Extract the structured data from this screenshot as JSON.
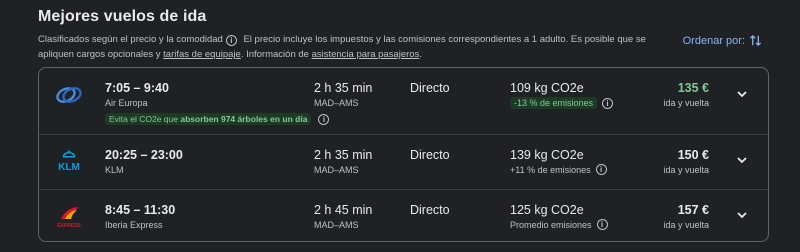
{
  "header": {
    "title": "Mejores vuelos de ida",
    "desc_part1": "Clasificados según el precio y la comodidad",
    "desc_part2": "El precio incluye los impuestos y las comisiones correspondientes a 1 adulto. Es posible que se apliquen cargos opcionales y ",
    "link_baggage": "tarifas de equipaje",
    "desc_part3": ". Información de ",
    "link_assist": "asistencia para pasajeros",
    "desc_part4": ".",
    "sort_label": "Ordenar por:"
  },
  "flights": [
    {
      "times": "7:05 – 9:40",
      "airline": "Air Europa",
      "eco_prefix": "Evita el CO2e que ",
      "eco_bold": "absorben 974 árboles en un día",
      "duration": "2 h 35 min",
      "route": "MAD–AMS",
      "stops": "Directo",
      "co2": "109 kg CO2e",
      "emissions": "-13 % de emisiones",
      "price": "135 €",
      "price_sub": "ida y vuelta",
      "logo_icon": "air-europa-logo"
    },
    {
      "times": "20:25 – 23:00",
      "airline": "KLM",
      "duration": "2 h 35 min",
      "route": "MAD–AMS",
      "stops": "Directo",
      "co2": "139 kg CO2e",
      "emissions": "+11 % de emisiones",
      "price": "150 €",
      "price_sub": "ida y vuelta",
      "logo_icon": "klm-logo",
      "logo_text": "KLM"
    },
    {
      "times": "8:45 – 11:30",
      "airline": "Iberia Express",
      "duration": "2 h 45 min",
      "route": "MAD–AMS",
      "stops": "Directo",
      "co2": "125 kg CO2e",
      "emissions": "Promedio emisiones",
      "price": "157 €",
      "price_sub": "ida y vuelta",
      "logo_icon": "iberia-express-logo",
      "logo_text": "EXPRESS"
    }
  ],
  "colors": {
    "background": "#202124",
    "accent": "#8ab4f8",
    "eco_green": "#81c995",
    "eco_bg": "#1e3a27"
  }
}
